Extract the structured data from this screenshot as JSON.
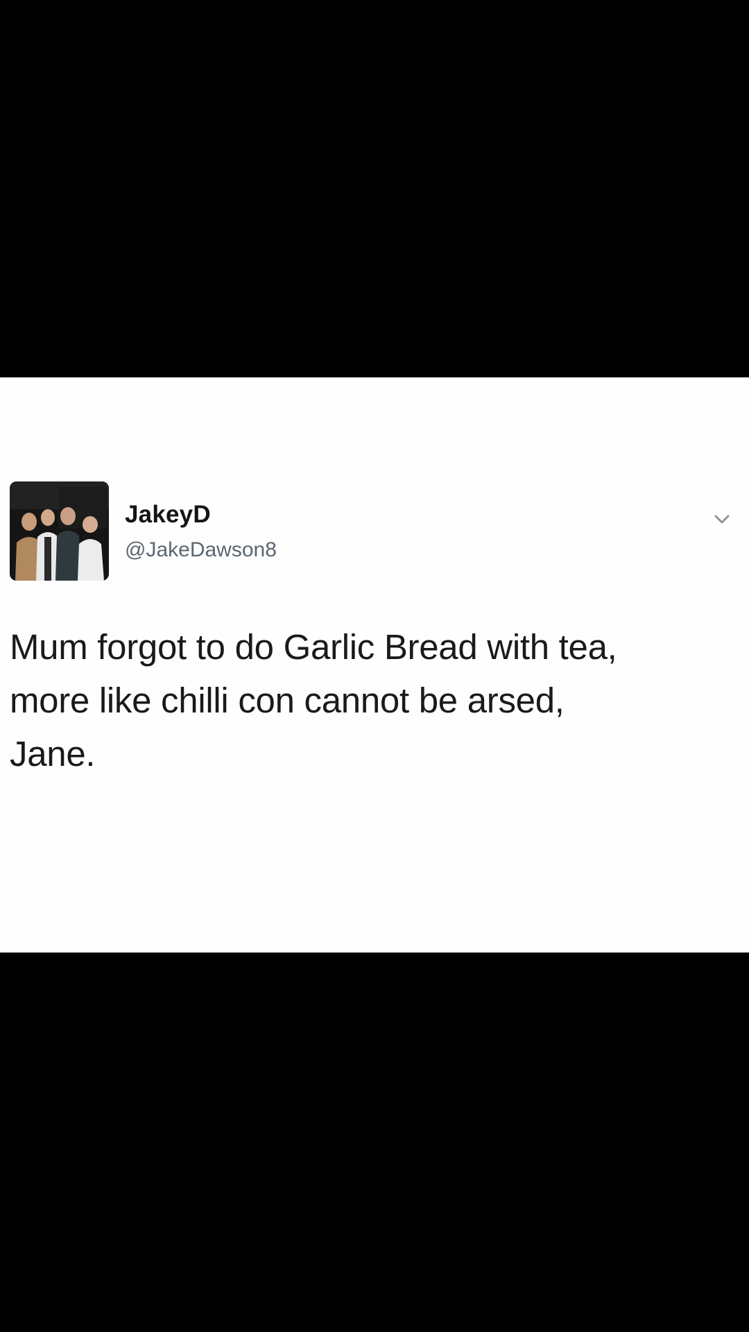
{
  "tweet": {
    "display_name": "JakeyD",
    "handle": "@JakeDawson8",
    "text": "Mum forgot to do Garlic Bread with tea,\nmore  like chilli con cannot be arsed,\nJane."
  },
  "icons": {
    "avatar": "profile-photo-group",
    "menu": "chevron-down-icon"
  },
  "colors": {
    "background_bars": "#000000",
    "card_background": "#fefefe",
    "name_text": "#141414",
    "handle_text": "#5b6670",
    "body_text": "#1a1a1a"
  }
}
